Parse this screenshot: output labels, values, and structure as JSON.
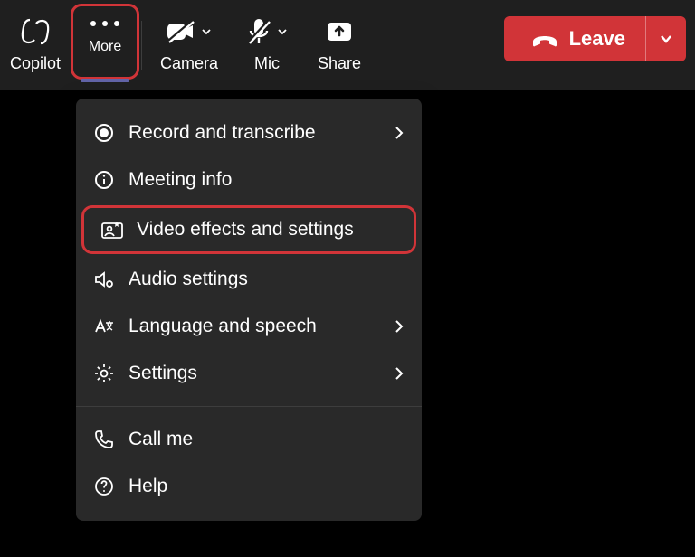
{
  "toolbar": {
    "copilot_label": "Copilot",
    "more_label": "More",
    "camera_label": "Camera",
    "mic_label": "Mic",
    "share_label": "Share",
    "leave_label": "Leave"
  },
  "menu": {
    "items": [
      {
        "label": "Record and transcribe",
        "has_submenu": true
      },
      {
        "label": "Meeting info",
        "has_submenu": false
      },
      {
        "label": "Video effects and settings",
        "has_submenu": false
      },
      {
        "label": "Audio settings",
        "has_submenu": false
      },
      {
        "label": "Language and speech",
        "has_submenu": true
      },
      {
        "label": "Settings",
        "has_submenu": true
      }
    ],
    "items2": [
      {
        "label": "Call me"
      },
      {
        "label": "Help"
      }
    ]
  }
}
